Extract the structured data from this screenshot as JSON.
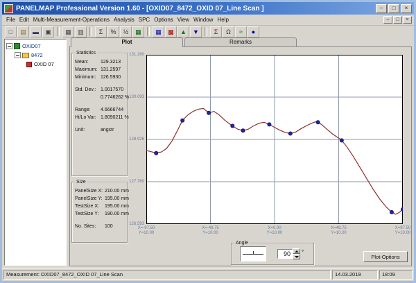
{
  "window": {
    "title": "PANELMAP  Professional Version 1.60 - [OXID07_8472_OXID 07_Line Scan ]",
    "buttons": {
      "minimize": "–",
      "maximize": "□",
      "close": "×"
    },
    "mdi_buttons": {
      "minimize": "–",
      "restore": "□",
      "close": "×"
    }
  },
  "menu": {
    "items": [
      {
        "label": "File"
      },
      {
        "label": "Edit"
      },
      {
        "label": "Multi-Measurement-Operations"
      },
      {
        "label": "Analysis"
      },
      {
        "label": "SPC"
      },
      {
        "label": "Options"
      },
      {
        "label": "View"
      },
      {
        "label": "Window"
      },
      {
        "label": "Help"
      }
    ]
  },
  "toolbar": {
    "buttons": [
      {
        "name": "new-icon",
        "glyph": "□",
        "color": "#505050"
      },
      {
        "name": "open-icon",
        "glyph": "▤",
        "color": "#8a6d1a"
      },
      {
        "name": "save-icon",
        "glyph": "▬",
        "color": "#303060"
      },
      {
        "name": "print-icon",
        "glyph": "▣",
        "color": "#404040"
      },
      {
        "sep": true
      },
      {
        "name": "tile-windows-icon",
        "glyph": "▦",
        "color": "#404040"
      },
      {
        "name": "cascade-windows-icon",
        "glyph": "▥",
        "color": "#404040"
      },
      {
        "sep": true
      },
      {
        "name": "sum-icon",
        "glyph": "Σ",
        "color": "#303030"
      },
      {
        "name": "percent-icon",
        "glyph": "%",
        "color": "#303030"
      },
      {
        "name": "ratio-icon",
        "glyph": "½",
        "color": "#303030"
      },
      {
        "name": "table-green-icon",
        "glyph": "▦",
        "color": "#006000"
      },
      {
        "sep": true
      },
      {
        "name": "map-blue-icon",
        "glyph": "▦",
        "color": "#0000a0"
      },
      {
        "name": "map-red-icon",
        "glyph": "▩",
        "color": "#a00000"
      },
      {
        "name": "chart-up-icon",
        "glyph": "▲",
        "color": "#008000"
      },
      {
        "name": "chart-down-icon",
        "glyph": "▼",
        "color": "#000090"
      },
      {
        "sep": true
      },
      {
        "name": "sigma-red-icon",
        "glyph": "Σ",
        "color": "#b00000"
      },
      {
        "name": "omega-icon",
        "glyph": "Ω",
        "color": "#303030"
      },
      {
        "name": "wave-green-icon",
        "glyph": "≈",
        "color": "#008000"
      },
      {
        "name": "dot-blue-icon",
        "glyph": "●",
        "color": "#0000a0"
      }
    ]
  },
  "tree": {
    "items": [
      {
        "label": "OXID07"
      },
      {
        "label": "8472"
      },
      {
        "label": "OXID 07"
      }
    ]
  },
  "tabs": [
    {
      "label": "Plot"
    },
    {
      "label": "Remarks"
    }
  ],
  "statistics": {
    "title": "Statistics",
    "rows": [
      {
        "label": "Mean:",
        "value": "129.3213"
      },
      {
        "label": "Maximum:",
        "value": "131.2597"
      },
      {
        "label": "Minimum:",
        "value": "126.5930"
      },
      {
        "label": "Std. Dev.:",
        "value": "1.0017570"
      },
      {
        "label": "",
        "value": "0.7746262 %"
      },
      {
        "label": "Range:",
        "value": "4.6666744"
      },
      {
        "label": "Hi/Lo Var:",
        "value": "1.8090211 %"
      },
      {
        "label": "Unit:",
        "value": "angstr"
      }
    ]
  },
  "size": {
    "title": "Size",
    "rows": [
      {
        "label": "PanelSize X:",
        "value": "210.00 mm"
      },
      {
        "label": "PanelSize Y:",
        "value": "195.00 mm"
      },
      {
        "label": "TestSize X:",
        "value": "195.00 mm"
      },
      {
        "label": "TestSize Y:",
        "value": "190.00 mm"
      },
      {
        "label": "No. Sites:",
        "value": "100"
      }
    ]
  },
  "angle": {
    "title": "Angle",
    "value": "90",
    "degree_symbol": "°"
  },
  "plot_options_label": "Plot-Options",
  "status": {
    "measurement": "Measurement: OXID07_8472_OXID 07_Line Scan",
    "date": "14.03.2019",
    "time": "18:09"
  },
  "chart_data": {
    "type": "line",
    "title": "",
    "xlabel": "",
    "ylabel": "",
    "x_range": [
      -97.5,
      97.5
    ],
    "y_range": [
      126.593,
      131.26
    ],
    "grid": true,
    "legend": false,
    "bg": "#ffffff",
    "border_color": "#000000",
    "grid_color": "#8e9aae",
    "line_color": "#8b3030",
    "marker_color": "#2424a8",
    "y_ticks": [
      {
        "v": 131.26,
        "label": "131.260"
      },
      {
        "v": 130.093,
        "label": "130.093"
      },
      {
        "v": 128.926,
        "label": "128.926"
      },
      {
        "v": 127.76,
        "label": "127.760"
      },
      {
        "v": 126.593,
        "label": "126.593"
      }
    ],
    "x_ticks": [
      {
        "v": -97.5,
        "l1": "X=-97.50",
        "l2": "Y=10.00"
      },
      {
        "v": -48.75,
        "l1": "X=-48.75",
        "l2": "Y=10.00"
      },
      {
        "v": 0,
        "l1": "X=0.00",
        "l2": "Y=10.00"
      },
      {
        "v": 48.75,
        "l1": "X=48.75",
        "l2": "Y=10.00"
      },
      {
        "v": 97.5,
        "l1": "X=97.50",
        "l2": "Y=10.00"
      }
    ],
    "line": [
      [
        -97.5,
        128.62
      ],
      [
        -93,
        128.58
      ],
      [
        -90,
        128.55
      ],
      [
        -86,
        128.58
      ],
      [
        -82,
        128.68
      ],
      [
        -78,
        128.88
      ],
      [
        -74,
        129.16
      ],
      [
        -70,
        129.45
      ],
      [
        -66,
        129.6
      ],
      [
        -62,
        129.7
      ],
      [
        -58,
        129.76
      ],
      [
        -54,
        129.78
      ],
      [
        -50,
        129.66
      ],
      [
        -46,
        129.7
      ],
      [
        -42,
        129.6
      ],
      [
        -38,
        129.46
      ],
      [
        -34,
        129.35
      ],
      [
        -32,
        129.3
      ],
      [
        -28,
        129.21
      ],
      [
        -24,
        129.17
      ],
      [
        -20,
        129.21
      ],
      [
        -16,
        129.3
      ],
      [
        -12,
        129.37
      ],
      [
        -8,
        129.4
      ],
      [
        -4,
        129.34
      ],
      [
        0,
        129.26
      ],
      [
        4,
        129.18
      ],
      [
        8,
        129.12
      ],
      [
        12,
        129.09
      ],
      [
        16,
        129.13
      ],
      [
        20,
        129.22
      ],
      [
        24,
        129.3
      ],
      [
        28,
        129.37
      ],
      [
        31,
        129.41
      ],
      [
        33,
        129.4
      ],
      [
        36,
        129.33
      ],
      [
        40,
        129.2
      ],
      [
        44,
        129.08
      ],
      [
        48,
        128.98
      ],
      [
        51,
        128.9
      ],
      [
        55,
        128.72
      ],
      [
        60,
        128.45
      ],
      [
        65,
        128.15
      ],
      [
        70,
        127.85
      ],
      [
        75,
        127.55
      ],
      [
        80,
        127.28
      ],
      [
        85,
        127.06
      ],
      [
        89,
        126.92
      ],
      [
        92,
        126.86
      ],
      [
        95,
        126.92
      ],
      [
        97.5,
        127.0
      ]
    ],
    "markers": [
      [
        -90,
        128.55
      ],
      [
        -70,
        129.45
      ],
      [
        -50,
        129.66
      ],
      [
        -32,
        129.3
      ],
      [
        -24,
        129.17
      ],
      [
        -4,
        129.34
      ],
      [
        12,
        129.09
      ],
      [
        33,
        129.4
      ],
      [
        51,
        128.9
      ],
      [
        89,
        126.92
      ],
      [
        97.5,
        127.0
      ]
    ]
  }
}
